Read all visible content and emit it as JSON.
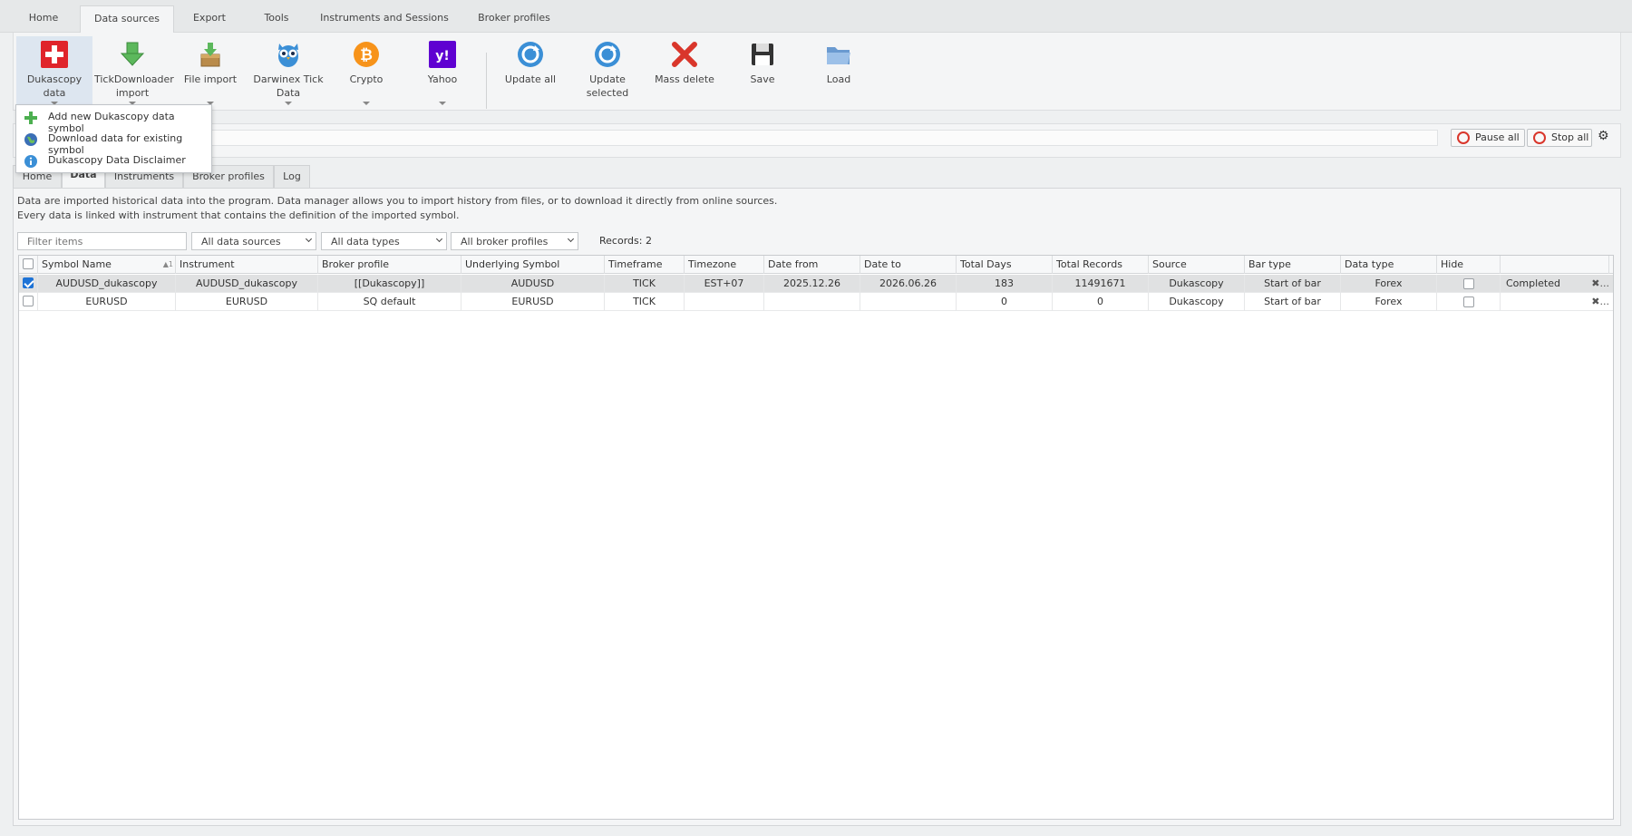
{
  "top_tabs": [
    "Home",
    "Data sources",
    "Export",
    "Tools",
    "Instruments and Sessions",
    "Broker profiles"
  ],
  "active_top_tab": "Data sources",
  "ribbon": {
    "dukascopy": "Dukascopy data",
    "tickdownloader": [
      "TickDownloader",
      "import"
    ],
    "file_import": "File import",
    "darwinex": [
      "Darwinex Tick",
      "Data"
    ],
    "crypto": "Crypto",
    "yahoo": "Yahoo",
    "update_all": "Update all",
    "update_selected": "Update selected",
    "mass_delete": "Mass delete",
    "save": "Save",
    "load": "Load"
  },
  "dropdown_menu": [
    {
      "label": "Add new Dukascopy data symbol",
      "icon": "plus-icon"
    },
    {
      "label": "Download data for existing symbol",
      "icon": "globe-icon"
    },
    {
      "label": "Dukascopy Data Disclaimer",
      "icon": "info-icon"
    }
  ],
  "controls": {
    "pause_all": "Pause all",
    "stop_all": "Stop all"
  },
  "sub_tabs": [
    "Home",
    "Data",
    "Instruments",
    "Broker profiles",
    "Log"
  ],
  "active_sub_tab": "Data",
  "description": [
    "Data are imported historical data into the program. Data manager allows you to import history from files, or to download it directly from online sources.",
    "Every data is linked with instrument that contains the definition of the imported symbol."
  ],
  "filters": {
    "filter_placeholder": "Filter items",
    "data_sources": "All data sources",
    "data_types": "All data types",
    "broker_profiles": "All broker profiles",
    "records": "Records: 2"
  },
  "table": {
    "columns": [
      "Symbol Name",
      "Instrument",
      "Broker profile",
      "Underlying Symbol",
      "Timeframe",
      "Timezone",
      "Date from",
      "Date to",
      "Total Days",
      "Total Records",
      "Source",
      "Bar type",
      "Data type",
      "Hide",
      ""
    ],
    "sort_indicator": "▲1",
    "rows": [
      {
        "checked": true,
        "symbol": "AUDUSD_dukascopy",
        "instrument": "AUDUSD_dukascopy",
        "broker": "[[Dukascopy]]",
        "underlying": "AUDUSD",
        "timeframe": "TICK",
        "timezone": "EST+07",
        "date_from": "2025.12.26",
        "date_to": "2026.06.26",
        "total_days": "183",
        "total_records": "11491671",
        "source": "Dukascopy",
        "bar_type": "Start of bar",
        "data_type": "Forex",
        "hide": false,
        "status": "Completed",
        "action": "✖..."
      },
      {
        "checked": false,
        "symbol": "EURUSD",
        "instrument": "EURUSD",
        "broker": "SQ default",
        "underlying": "EURUSD",
        "timeframe": "TICK",
        "timezone": "",
        "date_from": "",
        "date_to": "",
        "total_days": "0",
        "total_records": "0",
        "source": "Dukascopy",
        "bar_type": "Start of bar",
        "data_type": "Forex",
        "hide": false,
        "status": "",
        "action": "✖..."
      }
    ]
  },
  "colors": {
    "accent": "#1e73d6",
    "stop": "#d9362b",
    "dukascopy_red": "#e0242b",
    "yahoo_purple": "#5f01d1",
    "crypto_orange": "#f7931a"
  }
}
